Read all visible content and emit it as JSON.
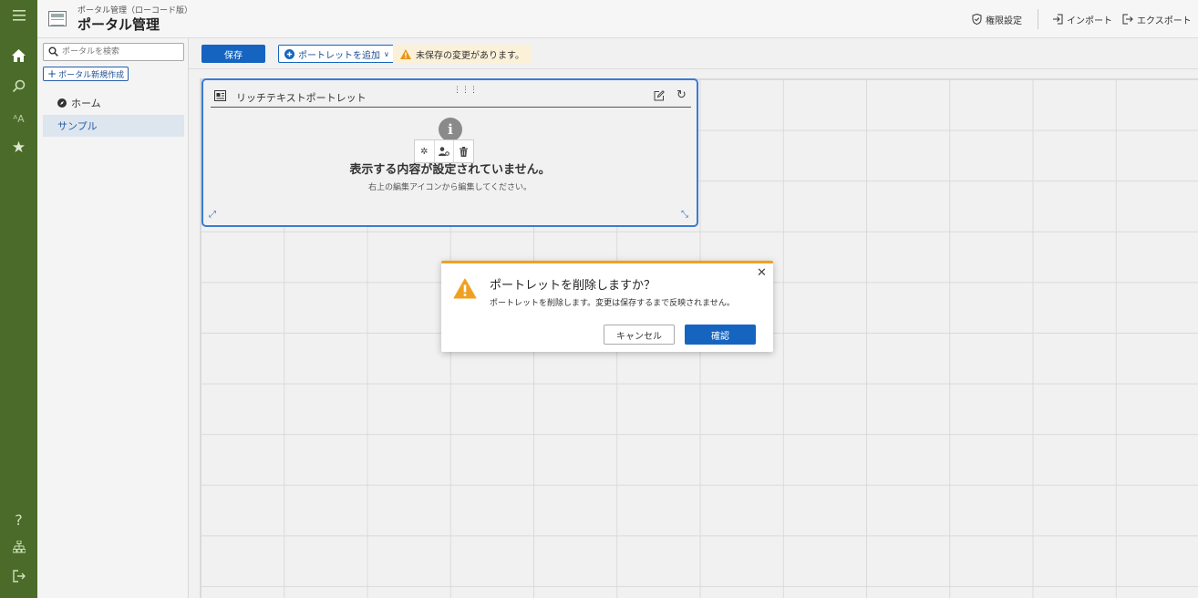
{
  "header": {
    "app_subtitle": "ポータル管理（ローコード版）",
    "app_title": "ポータル管理",
    "permission_label": "権限設定",
    "import_label": "インポート",
    "export_label": "エクスポート"
  },
  "sidebar": {
    "search_placeholder": "ポータルを検索",
    "new_portal_label": "ポータル新規作成",
    "items": [
      {
        "label": "ホーム",
        "icon": "compass-icon"
      },
      {
        "label": "サンプル"
      }
    ]
  },
  "toolbar": {
    "save_label": "保存",
    "add_portlet_label": "ポートレットを追加",
    "unsaved_message": "未保存の変更があります。"
  },
  "portlet": {
    "title": "リッチテキストポートレット",
    "empty_message": "表示する内容が設定されていません。",
    "hint": "右上の編集アイコンから編集してください。"
  },
  "dialog": {
    "title": "ポートレットを削除しますか？",
    "message": "ポートレットを削除します。変更は保存するまで反映されません。",
    "cancel_label": "キャンセル",
    "confirm_label": "確認"
  },
  "colors": {
    "rail": "#4a6b2a",
    "primary": "#1565c0",
    "warning": "#f0a020",
    "selection": "#3a7bd5"
  }
}
